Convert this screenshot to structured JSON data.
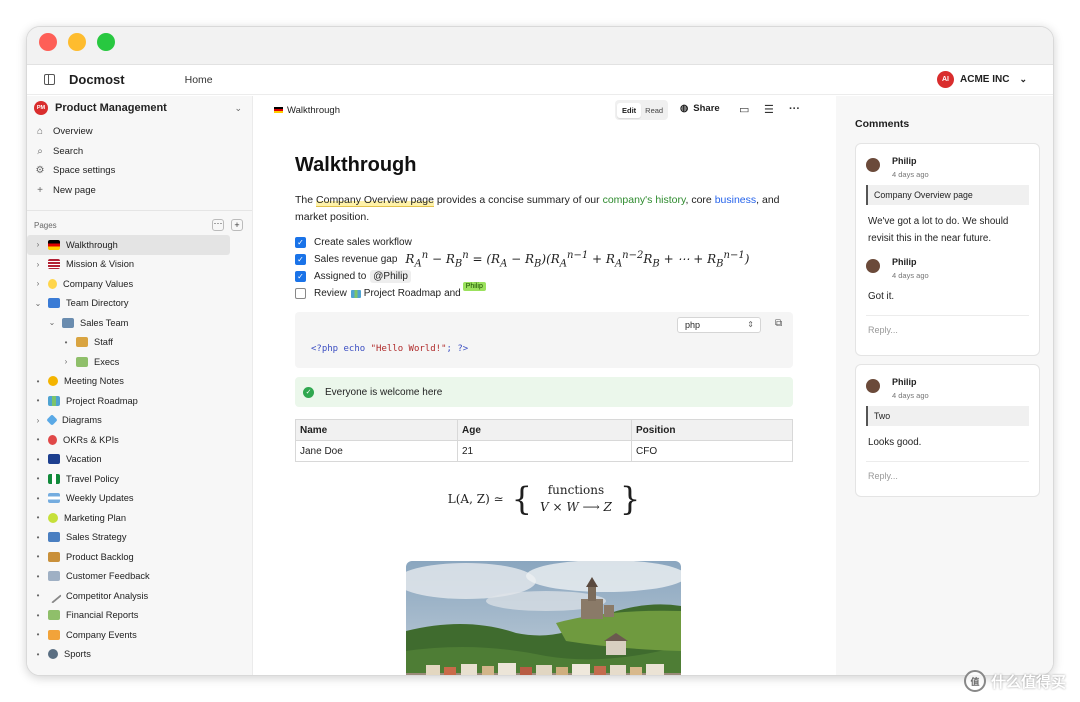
{
  "window": {
    "controls": [
      "close",
      "minimize",
      "maximize"
    ]
  },
  "header": {
    "brand": "Docmost",
    "home_link": "Home",
    "workspace_initials": "AI",
    "workspace_name": "ACME INC",
    "sidebar_toggle_icon": "sidebar-toggle-icon",
    "workspace_chevron_icon": "chevron-down-icon"
  },
  "sidebar": {
    "space_initials": "PM",
    "space_name": "Product Management",
    "menu": [
      {
        "label": "Overview",
        "icon": "home-icon"
      },
      {
        "label": "Search",
        "icon": "search-icon"
      },
      {
        "label": "Space settings",
        "icon": "gear-icon"
      },
      {
        "label": "New page",
        "icon": "plus-icon"
      }
    ],
    "pages_label": "Pages",
    "tree": [
      {
        "label": "Walkthrough",
        "emoji": "de-flag",
        "chev": "›",
        "indent": 0,
        "active": true
      },
      {
        "label": "Mission & Vision",
        "emoji": "us-flag",
        "chev": "›",
        "indent": 0
      },
      {
        "label": "Company Values",
        "emoji": "bulb",
        "chev": "›",
        "indent": 0
      },
      {
        "label": "Team Directory",
        "emoji": "directory",
        "chev": "⌄",
        "indent": 0
      },
      {
        "label": "Sales Team",
        "emoji": "people",
        "chev": "⌄",
        "indent": 1
      },
      {
        "label": "Staff",
        "emoji": "person",
        "chev": "•",
        "indent": 2
      },
      {
        "label": "Execs",
        "emoji": "money",
        "chev": "›",
        "indent": 2
      },
      {
        "label": "Meeting Notes",
        "emoji": "smile",
        "chev": "•",
        "indent": 0
      },
      {
        "label": "Project Roadmap",
        "emoji": "map",
        "chev": "•",
        "indent": 0
      },
      {
        "label": "Diagrams",
        "emoji": "diamond",
        "chev": "›",
        "indent": 0
      },
      {
        "label": "OKRs & KPIs",
        "emoji": "target",
        "chev": "•",
        "indent": 0
      },
      {
        "label": "Vacation",
        "emoji": "uk-flag",
        "chev": "•",
        "indent": 0
      },
      {
        "label": "Travel Policy",
        "emoji": "ng-flag",
        "chev": "•",
        "indent": 0
      },
      {
        "label": "Weekly Updates",
        "emoji": "ar-flag",
        "chev": "•",
        "indent": 0
      },
      {
        "label": "Marketing Plan",
        "emoji": "tennis",
        "chev": "•",
        "indent": 0
      },
      {
        "label": "Sales Strategy",
        "emoji": "chart",
        "chev": "•",
        "indent": 0
      },
      {
        "label": "Product Backlog",
        "emoji": "person2",
        "chev": "•",
        "indent": 0
      },
      {
        "label": "Customer Feedback",
        "emoji": "card",
        "chev": "•",
        "indent": 0
      },
      {
        "label": "Competitor Analysis",
        "emoji": "pen",
        "chev": "•",
        "indent": 0
      },
      {
        "label": "Financial Reports",
        "emoji": "money",
        "chev": "•",
        "indent": 0
      },
      {
        "label": "Company Events",
        "emoji": "party",
        "chev": "•",
        "indent": 0
      },
      {
        "label": "Sports",
        "emoji": "bike",
        "chev": "•",
        "indent": 0
      }
    ]
  },
  "editor": {
    "breadcrumb": "Walkthrough",
    "mode_edit": "Edit",
    "mode_read": "Read",
    "share_label": "Share",
    "title": "Walkthrough",
    "intro": {
      "t1": "The ",
      "link1": "Company Overview page",
      "t2": " provides a concise summary of our ",
      "link2": "company's history",
      "t3": ", core ",
      "link3": "business",
      "t4": ", and market position."
    },
    "tasks": [
      {
        "label": "Create sales workflow",
        "checked": true
      },
      {
        "label": "Sales revenue gap",
        "checked": true,
        "math": "Rⁿ_A − Rⁿ_B = (R_A − R_B)(Rⁿ⁻¹_A + Rⁿ⁻²_A R_B + ⋯ + Rⁿ⁻¹_B)"
      },
      {
        "label": "Assigned to",
        "checked": true,
        "mention": "@Philip"
      },
      {
        "label": "Review",
        "checked": false,
        "ref": "Project Roadmap",
        "suffix": "and",
        "cursor": "Philip"
      }
    ],
    "code": {
      "language": "php",
      "open": "<?php",
      "fn": "echo",
      "str": "\"Hello World!\"",
      "close": "; ?>"
    },
    "callout": "Everyone is welcome here",
    "table": {
      "headers": [
        "Name",
        "Age",
        "Position"
      ],
      "rows": [
        [
          "Jane Doe",
          "21",
          "CFO"
        ]
      ]
    },
    "math_block": {
      "lhs": "L(A, Z) ≃",
      "top": "functions",
      "bottom": "V × W  ⟶  Z"
    }
  },
  "comments": {
    "title": "Comments",
    "reply_placeholder": "Reply...",
    "threads": [
      {
        "quote": "Company Overview page",
        "items": [
          {
            "author": "Philip",
            "time": "4 days ago",
            "body": "We've got a lot to do. We should revisit this in the near future."
          },
          {
            "author": "Philip",
            "time": "4 days ago",
            "body": "Got it."
          }
        ]
      },
      {
        "quote": "Two",
        "items": [
          {
            "author": "Philip",
            "time": "4 days ago",
            "body": "Looks good."
          }
        ]
      }
    ]
  },
  "watermark": {
    "badge": "值",
    "text": "什么值得买"
  }
}
